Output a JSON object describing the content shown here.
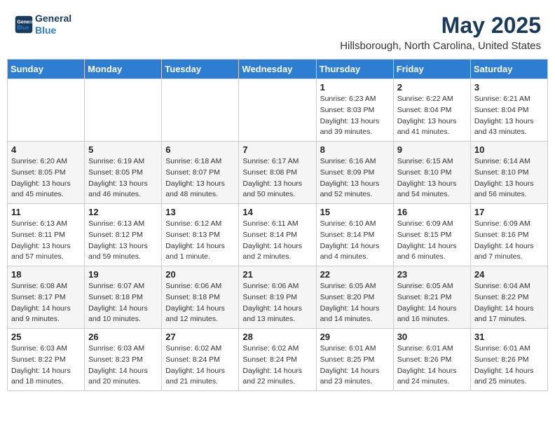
{
  "header": {
    "logo_line1": "General",
    "logo_line2": "Blue",
    "title": "May 2025",
    "subtitle": "Hillsborough, North Carolina, United States"
  },
  "weekdays": [
    "Sunday",
    "Monday",
    "Tuesday",
    "Wednesday",
    "Thursday",
    "Friday",
    "Saturday"
  ],
  "weeks": [
    [
      {
        "day": "",
        "sunrise": "",
        "sunset": "",
        "daylight": ""
      },
      {
        "day": "",
        "sunrise": "",
        "sunset": "",
        "daylight": ""
      },
      {
        "day": "",
        "sunrise": "",
        "sunset": "",
        "daylight": ""
      },
      {
        "day": "",
        "sunrise": "",
        "sunset": "",
        "daylight": ""
      },
      {
        "day": "1",
        "sunrise": "Sunrise: 6:23 AM",
        "sunset": "Sunset: 8:03 PM",
        "daylight": "Daylight: 13 hours and 39 minutes."
      },
      {
        "day": "2",
        "sunrise": "Sunrise: 6:22 AM",
        "sunset": "Sunset: 8:04 PM",
        "daylight": "Daylight: 13 hours and 41 minutes."
      },
      {
        "day": "3",
        "sunrise": "Sunrise: 6:21 AM",
        "sunset": "Sunset: 8:04 PM",
        "daylight": "Daylight: 13 hours and 43 minutes."
      }
    ],
    [
      {
        "day": "4",
        "sunrise": "Sunrise: 6:20 AM",
        "sunset": "Sunset: 8:05 PM",
        "daylight": "Daylight: 13 hours and 45 minutes."
      },
      {
        "day": "5",
        "sunrise": "Sunrise: 6:19 AM",
        "sunset": "Sunset: 8:05 PM",
        "daylight": "Daylight: 13 hours and 46 minutes."
      },
      {
        "day": "6",
        "sunrise": "Sunrise: 6:18 AM",
        "sunset": "Sunset: 8:07 PM",
        "daylight": "Daylight: 13 hours and 48 minutes."
      },
      {
        "day": "7",
        "sunrise": "Sunrise: 6:17 AM",
        "sunset": "Sunset: 8:08 PM",
        "daylight": "Daylight: 13 hours and 50 minutes."
      },
      {
        "day": "8",
        "sunrise": "Sunrise: 6:16 AM",
        "sunset": "Sunset: 8:09 PM",
        "daylight": "Daylight: 13 hours and 52 minutes."
      },
      {
        "day": "9",
        "sunrise": "Sunrise: 6:15 AM",
        "sunset": "Sunset: 8:10 PM",
        "daylight": "Daylight: 13 hours and 54 minutes."
      },
      {
        "day": "10",
        "sunrise": "Sunrise: 6:14 AM",
        "sunset": "Sunset: 8:10 PM",
        "daylight": "Daylight: 13 hours and 56 minutes."
      }
    ],
    [
      {
        "day": "11",
        "sunrise": "Sunrise: 6:13 AM",
        "sunset": "Sunset: 8:11 PM",
        "daylight": "Daylight: 13 hours and 57 minutes."
      },
      {
        "day": "12",
        "sunrise": "Sunrise: 6:13 AM",
        "sunset": "Sunset: 8:12 PM",
        "daylight": "Daylight: 13 hours and 59 minutes."
      },
      {
        "day": "13",
        "sunrise": "Sunrise: 6:12 AM",
        "sunset": "Sunset: 8:13 PM",
        "daylight": "Daylight: 14 hours and 1 minute."
      },
      {
        "day": "14",
        "sunrise": "Sunrise: 6:11 AM",
        "sunset": "Sunset: 8:14 PM",
        "daylight": "Daylight: 14 hours and 2 minutes."
      },
      {
        "day": "15",
        "sunrise": "Sunrise: 6:10 AM",
        "sunset": "Sunset: 8:14 PM",
        "daylight": "Daylight: 14 hours and 4 minutes."
      },
      {
        "day": "16",
        "sunrise": "Sunrise: 6:09 AM",
        "sunset": "Sunset: 8:15 PM",
        "daylight": "Daylight: 14 hours and 6 minutes."
      },
      {
        "day": "17",
        "sunrise": "Sunrise: 6:09 AM",
        "sunset": "Sunset: 8:16 PM",
        "daylight": "Daylight: 14 hours and 7 minutes."
      }
    ],
    [
      {
        "day": "18",
        "sunrise": "Sunrise: 6:08 AM",
        "sunset": "Sunset: 8:17 PM",
        "daylight": "Daylight: 14 hours and 9 minutes."
      },
      {
        "day": "19",
        "sunrise": "Sunrise: 6:07 AM",
        "sunset": "Sunset: 8:18 PM",
        "daylight": "Daylight: 14 hours and 10 minutes."
      },
      {
        "day": "20",
        "sunrise": "Sunrise: 6:06 AM",
        "sunset": "Sunset: 8:18 PM",
        "daylight": "Daylight: 14 hours and 12 minutes."
      },
      {
        "day": "21",
        "sunrise": "Sunrise: 6:06 AM",
        "sunset": "Sunset: 8:19 PM",
        "daylight": "Daylight: 14 hours and 13 minutes."
      },
      {
        "day": "22",
        "sunrise": "Sunrise: 6:05 AM",
        "sunset": "Sunset: 8:20 PM",
        "daylight": "Daylight: 14 hours and 14 minutes."
      },
      {
        "day": "23",
        "sunrise": "Sunrise: 6:05 AM",
        "sunset": "Sunset: 8:21 PM",
        "daylight": "Daylight: 14 hours and 16 minutes."
      },
      {
        "day": "24",
        "sunrise": "Sunrise: 6:04 AM",
        "sunset": "Sunset: 8:22 PM",
        "daylight": "Daylight: 14 hours and 17 minutes."
      }
    ],
    [
      {
        "day": "25",
        "sunrise": "Sunrise: 6:03 AM",
        "sunset": "Sunset: 8:22 PM",
        "daylight": "Daylight: 14 hours and 18 minutes."
      },
      {
        "day": "26",
        "sunrise": "Sunrise: 6:03 AM",
        "sunset": "Sunset: 8:23 PM",
        "daylight": "Daylight: 14 hours and 20 minutes."
      },
      {
        "day": "27",
        "sunrise": "Sunrise: 6:02 AM",
        "sunset": "Sunset: 8:24 PM",
        "daylight": "Daylight: 14 hours and 21 minutes."
      },
      {
        "day": "28",
        "sunrise": "Sunrise: 6:02 AM",
        "sunset": "Sunset: 8:24 PM",
        "daylight": "Daylight: 14 hours and 22 minutes."
      },
      {
        "day": "29",
        "sunrise": "Sunrise: 6:01 AM",
        "sunset": "Sunset: 8:25 PM",
        "daylight": "Daylight: 14 hours and 23 minutes."
      },
      {
        "day": "30",
        "sunrise": "Sunrise: 6:01 AM",
        "sunset": "Sunset: 8:26 PM",
        "daylight": "Daylight: 14 hours and 24 minutes."
      },
      {
        "day": "31",
        "sunrise": "Sunrise: 6:01 AM",
        "sunset": "Sunset: 8:26 PM",
        "daylight": "Daylight: 14 hours and 25 minutes."
      }
    ]
  ]
}
